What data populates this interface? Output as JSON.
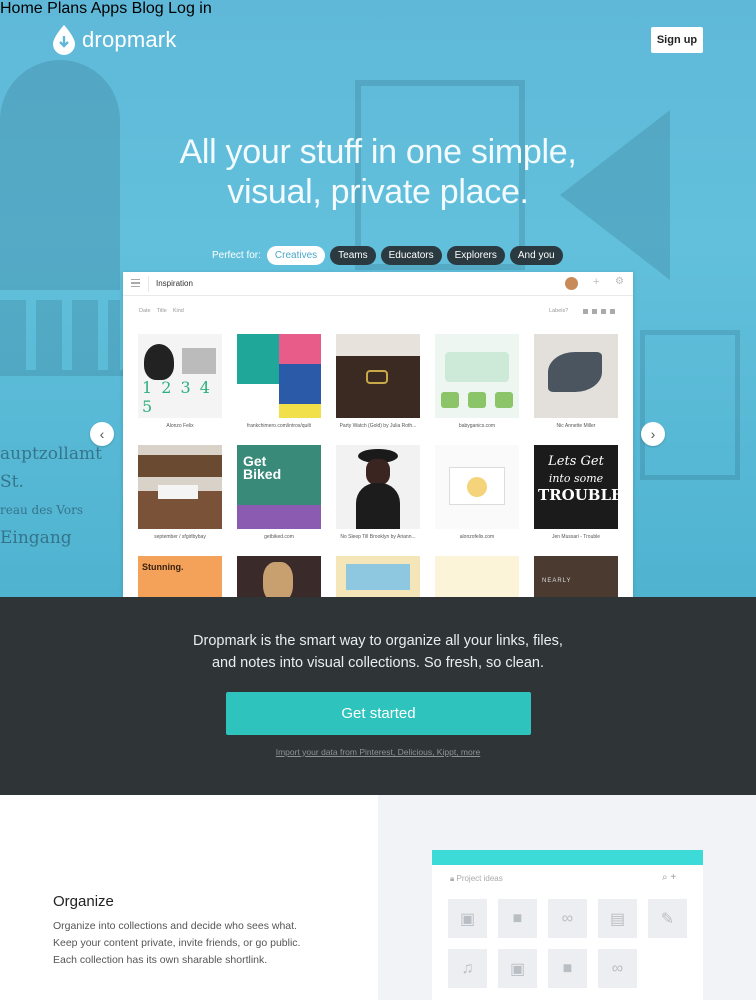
{
  "brand": {
    "name": "dropmark"
  },
  "nav": {
    "items": [
      "Home",
      "Plans",
      "Apps",
      "Blog",
      "Log in"
    ],
    "signup": "Sign up"
  },
  "hero": {
    "headline_line1": "All your stuff in one simple,",
    "headline_line2": "visual, private place.",
    "perfect_for": "Perfect for:",
    "pills": [
      "Creatives",
      "Teams",
      "Educators",
      "Explorers",
      "And you"
    ],
    "active_pill": "Creatives"
  },
  "app": {
    "collection": "Inspiration",
    "sort": [
      "Date",
      "Title",
      "Kind"
    ],
    "labels": "Labels?",
    "captions": [
      "Alonzo Felix",
      "frankchimero.com/intros/quilt",
      "Party Watch (Gold) by Julia Roth...",
      "babyganics.com",
      "Nic Annette Miller",
      "september / sfgirlbybay",
      "getbiked.com",
      "No Sleep Till Brooklyn by Ariann...",
      "alonzofelix.com",
      "Jen Mussari - Trouble",
      "",
      "",
      "",
      "",
      ""
    ],
    "tile_texts": {
      "numbers": "1 2 3 4 5",
      "get_biked": "Get Biked",
      "lets_get": "Lets Get",
      "into_some": "into some",
      "trouble": "TROUBLE",
      "stunning": "Stunning.",
      "nearly": "NEARLY"
    }
  },
  "bg_sign": {
    "line1": "auptzollamt St.",
    "line2": "reau des Vors",
    "line3": "Eingang"
  },
  "band": {
    "text_line1": "Dropmark is the smart way to organize all your links, files,",
    "text_line2": "and notes into visual collections. So fresh, so clean.",
    "cta": "Get started",
    "import": "Import your data from Pinterest, Delicious, Kippt, more"
  },
  "organize": {
    "title": "Organize",
    "body_line1": "Organize into collections and decide who sees what.",
    "body_line2": "Keep your content private, invite friends, or go public.",
    "body_line3": "Each collection has its own sharable shortlink.",
    "card_label": "Project ideas",
    "icons": [
      "image-icon",
      "video-icon",
      "link-icon",
      "document-icon",
      "pencil-icon",
      "music-icon",
      "image-icon",
      "video-icon",
      "link-icon"
    ]
  },
  "colors": {
    "hero": "#5fb8d8",
    "band": "#2f3437",
    "cta": "#2fc3bd",
    "card_accent": "#3ddbd8",
    "pill_dark": "#2b3940"
  }
}
